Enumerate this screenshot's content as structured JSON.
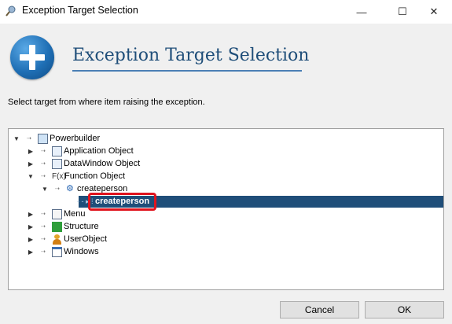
{
  "window": {
    "title": "Exception Target Selection",
    "minimize": "—",
    "maximize": "☐",
    "close": "✕"
  },
  "header": {
    "title": "Exception Target Selection"
  },
  "instruction": "Select target from where item raising the exception.",
  "tree": {
    "root": {
      "label": "Powerbuilder"
    },
    "items": [
      {
        "label": "Application Object",
        "icon": "application-object-icon"
      },
      {
        "label": "DataWindow Object",
        "icon": "datawindow-icon"
      },
      {
        "label": "Function Object",
        "icon": "function-icon"
      },
      {
        "label": "createperson",
        "icon": "gear-icon"
      },
      {
        "label": "createperson",
        "icon": "function-leaf-icon"
      },
      {
        "label": "Menu",
        "icon": "menu-icon"
      },
      {
        "label": "Structure",
        "icon": "structure-icon"
      },
      {
        "label": "UserObject",
        "icon": "user-object-icon"
      },
      {
        "label": "Windows",
        "icon": "window-icon"
      }
    ],
    "selected": "createperson"
  },
  "buttons": {
    "cancel": "Cancel",
    "ok": "OK"
  },
  "colors": {
    "selection": "#1f4e79",
    "highlight": "#e0141e",
    "title": "#1f4e79"
  }
}
